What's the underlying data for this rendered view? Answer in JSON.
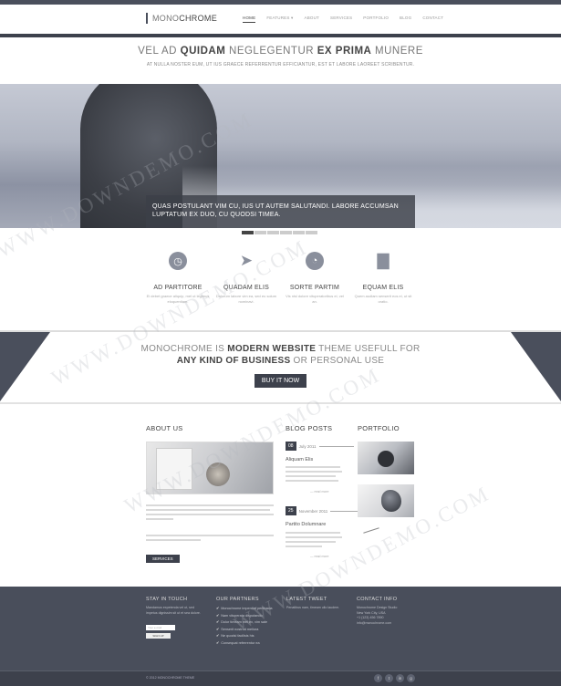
{
  "logo": {
    "part1": "MONO",
    "part2": "CHROME"
  },
  "nav": [
    {
      "label": "HOME",
      "active": true
    },
    {
      "label": "FEATURES ▾",
      "active": false
    },
    {
      "label": "ABOUT",
      "active": false
    },
    {
      "label": "SERVICES",
      "active": false
    },
    {
      "label": "PORTFOLIO",
      "active": false
    },
    {
      "label": "BLOG",
      "active": false
    },
    {
      "label": "CONTACT",
      "active": false
    }
  ],
  "intro": {
    "h1_a": "VEL AD ",
    "h1_b": "QUIDAM",
    "h1_c": " NEGLEGENTUR ",
    "h1_d": "EX PRIMA",
    "h1_e": " MUNERE",
    "sub": "AT NULLA NOSTER EUM, UT IUS GRAECE REFERRENTUR EFFICIANTUR, EST ET LABORE LAOREET SCRIBENTUR."
  },
  "hero": {
    "caption_line1": "QUAS POSTULANT VIM CU, IUS UT AUTEM SALUTANDI. LABORE ACCUMSAN",
    "caption_line2": "LUPTATUM EX DUO, CU QUODSI TIMEA.",
    "slides_total": 6,
    "slide_active": 1
  },
  "features": [
    {
      "icon": "clock-icon",
      "glyph": "◷",
      "title": "AD PARTITORE",
      "text": "Ei debet graece aliquip, mel ut legimus eloquentiam."
    },
    {
      "icon": "paper-plane-icon",
      "glyph": "➤",
      "title": "QUADAM ELIS",
      "text": "Dolorum labore vim ea, sed eu solum nominavi."
    },
    {
      "icon": "pie-chart-icon",
      "glyph": "◔",
      "title": "SORTE PARTIM",
      "text": "Vis nisl dolore vituperatoribus ei, vel an."
    },
    {
      "icon": "bar-chart-icon",
      "glyph": "▇",
      "title": "EQUAM ELIS",
      "text": "Quem audiam senserit eos ei, ut sit oratio."
    }
  ],
  "cta": {
    "a": "MONOCHROME IS ",
    "b": "MODERN WEBSITE",
    "c": " THEME USEFULL FOR",
    "d": "ANY KIND OF BUSINESS",
    "e": " OR PERSONAL USE",
    "button": "BUY IT NOW"
  },
  "about": {
    "title": "ABOUT US",
    "button": "SERVICES"
  },
  "blog": {
    "title": "BLOG POSTS",
    "posts": [
      {
        "day": "08",
        "month": "July 2011",
        "title": "Aliquam Elis",
        "more": "— read more"
      },
      {
        "day": "25",
        "month": "November 2011",
        "title": "Partito Dolumnare",
        "more": "— read more"
      }
    ]
  },
  "portfolio": {
    "title": "PORTFOLIO"
  },
  "footer": {
    "stay": {
      "title": "STAY IN TOUCH",
      "text": "Mandamus expetenda vel ut, sed impetus dignissim sit ut et sea dolore.",
      "input_placeholder": "Your e-mail",
      "button": "SIGN UP"
    },
    "partners": {
      "title": "OUR PARTNERS",
      "items": [
        "Monochrome imperdiet pertinacia",
        "Nam vituperata disputando",
        "Dolor timeam mei ex, vim sale",
        "Senserit nostrud meliora",
        "Ne quodsi facilisis his",
        "Consequat referrentur ea"
      ]
    },
    "tweet": {
      "title": "LATEST TWEET",
      "text": "Penatibus nam, timeam ullo laudem."
    },
    "contact": {
      "title": "CONTACT INFO",
      "lines": [
        "Monochrome Design Studio",
        "New York City, USA",
        "+1 (123) 456 7890",
        "info@monochrome.com"
      ]
    }
  },
  "bottom": {
    "copyright": "© 2012 MONOCHROME THEME",
    "social": [
      "f",
      "t",
      "in",
      "g"
    ]
  },
  "watermark": "WWW.DOWNDEMO.COM"
}
